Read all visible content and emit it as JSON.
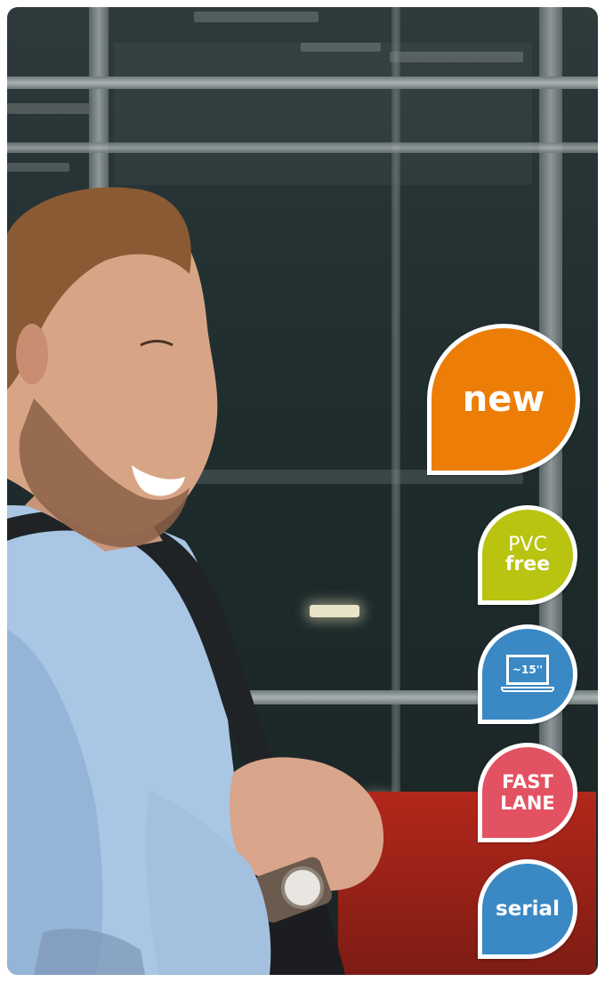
{
  "colors": {
    "new": "#ec7d06",
    "pvc": "#b8c40f",
    "laptop": "#3a88c4",
    "fast": "#e25262",
    "serial": "#3a88c4"
  },
  "badges": {
    "new": "new",
    "pvc_line1": "PVC",
    "pvc_line2": "free",
    "laptop_size": "~15''",
    "fast_line1": "FAST",
    "fast_line2": "LANE",
    "serial": "serial"
  },
  "icons": {
    "laptop": "laptop-icon"
  }
}
